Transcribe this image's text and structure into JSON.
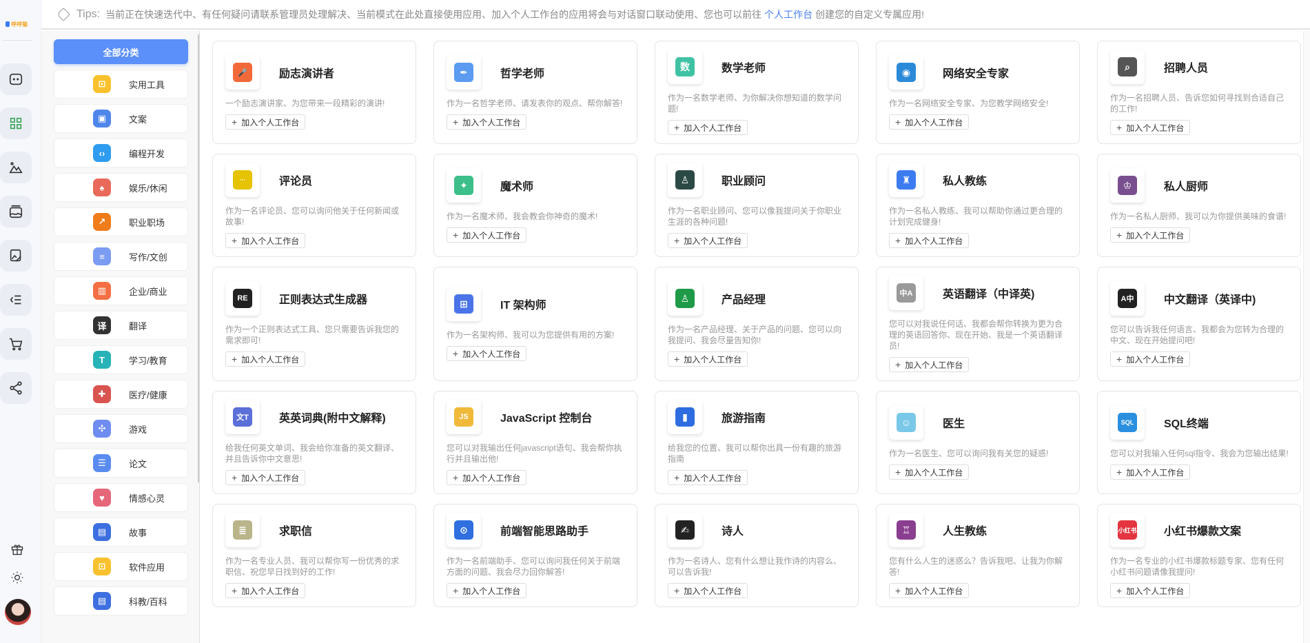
{
  "logo_text": "呼呼猫",
  "header": {
    "tips_label": "Tips:",
    "tips_before": "当前正在快速迭代中、有任何疑问请联系管理员处理解决、当前模式在此处直接使用应用、加入个人工作台的应用将会与对话窗口联动使用、您也可以前往",
    "tips_link": "个人工作台",
    "tips_after": "创建您的自定义专属应用!"
  },
  "rail": {
    "items": [
      {
        "name": "chat-icon"
      },
      {
        "name": "apps-grid-icon",
        "active": true
      },
      {
        "name": "image-mountain-icon"
      },
      {
        "name": "gallery-icon"
      },
      {
        "name": "image-edit-icon"
      },
      {
        "name": "menu-collapse-icon"
      },
      {
        "name": "cart-icon"
      },
      {
        "name": "share-icon"
      }
    ],
    "bottom": [
      {
        "name": "gift-icon"
      },
      {
        "name": "sun-icon"
      }
    ]
  },
  "categories": {
    "all_label": "全部分类",
    "items": [
      {
        "label": "实用工具",
        "icon": "toolbox-icon",
        "color": "#f8c12d",
        "glyph": "⊡"
      },
      {
        "label": "文案",
        "icon": "copywriting-icon",
        "color": "#4f86ec",
        "glyph": "▣"
      },
      {
        "label": "编程开发",
        "icon": "code-icon",
        "color": "#2f9cf0",
        "glyph": "‹›"
      },
      {
        "label": "娱乐/休闲",
        "icon": "cards-dice-icon",
        "color": "#e96a5a",
        "glyph": "♠"
      },
      {
        "label": "职业职场",
        "icon": "career-chart-icon",
        "color": "#f07c1a",
        "glyph": "↗"
      },
      {
        "label": "写作/文创",
        "icon": "writing-icon",
        "color": "#7b9cf2",
        "glyph": "≡"
      },
      {
        "label": "企业/商业",
        "icon": "building-icon",
        "color": "#f46f43",
        "glyph": "▥"
      },
      {
        "label": "翻译",
        "icon": "translate-icon",
        "color": "#333333",
        "glyph": "译"
      },
      {
        "label": "学习/教育",
        "icon": "education-icon",
        "color": "#27b3b8",
        "glyph": "T"
      },
      {
        "label": "医疗/健康",
        "icon": "medical-icon",
        "color": "#d9534f",
        "glyph": "✚"
      },
      {
        "label": "游戏",
        "icon": "gamepad-icon",
        "color": "#6f8df0",
        "glyph": "✣"
      },
      {
        "label": "论文",
        "icon": "paper-doc-icon",
        "color": "#5a8cf0",
        "glyph": "☰"
      },
      {
        "label": "情感心灵",
        "icon": "hearts-icon",
        "color": "#e6667a",
        "glyph": "♥"
      },
      {
        "label": "故事",
        "icon": "book-icon",
        "color": "#3d6fe0",
        "glyph": "▤"
      },
      {
        "label": "软件应用",
        "icon": "toolbox-icon",
        "color": "#f8c12d",
        "glyph": "⊡"
      },
      {
        "label": "科教/百科",
        "icon": "book-icon",
        "color": "#3d6fe0",
        "glyph": "▤"
      }
    ]
  },
  "card_button_label": "加入个人工作台",
  "cards": [
    {
      "title": "励志演讲者",
      "desc": "一个励志演讲家、为您带来一段精彩的演讲!",
      "icon": "microphone-icon",
      "color": "#f26a3a",
      "glyph": "🎤"
    },
    {
      "title": "哲学老师",
      "desc": "作为一名哲学老师、请发表你的观点、帮你解答!",
      "icon": "feather-pen-icon",
      "color": "#5b9bf0",
      "glyph": "✒"
    },
    {
      "title": "数学老师",
      "desc": "作为一名数学老师、为你解决你想知道的数学问题!",
      "icon": "math-book-icon",
      "color": "#3fc2a4",
      "glyph": "数"
    },
    {
      "title": "网络安全专家",
      "desc": "作为一名网络安全专家、为您教学网络安全!",
      "icon": "globe-shield-icon",
      "color": "#2b8ad8",
      "glyph": "◉"
    },
    {
      "title": "招聘人员",
      "desc": "作为一名招聘人员、告诉您如何寻找到合适自己的工作!",
      "icon": "recruiter-monitor-icon",
      "color": "#555555",
      "glyph": "⌕"
    },
    {
      "title": "评论员",
      "desc": "作为一名评论员、您可以询问他关于任何新闻或故事!",
      "icon": "comment-bubble-icon",
      "color": "#e5c300",
      "glyph": "···"
    },
    {
      "title": "魔术师",
      "desc": "作为一名魔术师、我会教会你神奇的魔术!",
      "icon": "magic-hat-icon",
      "color": "#3cbf8a",
      "glyph": "✦"
    },
    {
      "title": "职业顾问",
      "desc": "作为一名职业顾问、您可以像我提问关于你职业生涯的各种问题!",
      "icon": "career-advisor-icon",
      "color": "#2c4a45",
      "glyph": "♙"
    },
    {
      "title": "私人教练",
      "desc": "作为一名私人教练、我可以帮助你通过更合理的计划完成健身!",
      "icon": "muscle-trainer-icon",
      "color": "#3d7bf0",
      "glyph": "♜"
    },
    {
      "title": "私人厨师",
      "desc": "作为一名私人厨师、我可以为你提供美味的食谱!",
      "icon": "chef-icon",
      "color": "#7a4f8f",
      "glyph": "♔"
    },
    {
      "title": "正则表达式生成器",
      "desc": "作为一个正则表达式工具、您只需要告诉我您的需求即可!",
      "icon": "regex-icon",
      "color": "#222222",
      "glyph": "RE"
    },
    {
      "title": "IT 架构师",
      "desc": "作为一名架构师、我可以为您提供有用的方案!",
      "icon": "architecture-tree-icon",
      "color": "#4a74e8",
      "glyph": "⊞"
    },
    {
      "title": "产品经理",
      "desc": "作为一名产品经理、关于产品的问题、您可以向我提问、我会尽量告知你!",
      "icon": "product-manager-icon",
      "color": "#1f9a48",
      "glyph": "♙"
    },
    {
      "title": "英语翻译（中译英)",
      "desc": "您可以对我说任何话、我都会帮你转换为更为合理的英语回答你、现在开始、我是一个英语翻译员!",
      "icon": "zh-to-en-icon",
      "color": "#9a9a9a",
      "glyph": "中A"
    },
    {
      "title": "中文翻译（英译中)",
      "desc": "您可以告诉我任何语言、我都会为您转为合理的中文、现在开始提问吧!",
      "icon": "en-to-zh-icon",
      "color": "#222222",
      "glyph": "A中"
    },
    {
      "title": "英英词典(附中文解释)",
      "desc": "给我任何英文单词、我会给你准备的英文翻译、并且告诉你中文意思!",
      "icon": "dictionary-icon",
      "color": "#5b6fd8",
      "glyph": "文T"
    },
    {
      "title": "JavaScript 控制台",
      "desc": "您可以对我输出任何javascript语句、我会帮你执行并且输出他!",
      "icon": "js-file-icon",
      "color": "#f0b93a",
      "glyph": "JS"
    },
    {
      "title": "旅游指南",
      "desc": "给我您的位置、我可以帮你出具一份有趣的旅游指南",
      "icon": "travel-guide-icon",
      "color": "#2d6de0",
      "glyph": "▮"
    },
    {
      "title": "医生",
      "desc": "作为一名医生、您可以询问我有关您的疑惑!",
      "icon": "doctor-icon",
      "color": "#7ac8e8",
      "glyph": "☺"
    },
    {
      "title": "SQL终端",
      "desc": "您可以对我输入任何sql指令、我会为您输出结果!",
      "icon": "sql-file-icon",
      "color": "#2b8fe0",
      "glyph": "SQL"
    },
    {
      "title": "求职信",
      "desc": "作为一名专业人员、我可以帮你写一份优秀的求职信、祝您早日找到好的工作!",
      "icon": "cover-letter-icon",
      "color": "#b9b48a",
      "glyph": "≣"
    },
    {
      "title": "前端智能思路助手",
      "desc": "作为一名前端助手、您可以询问我任何关于前端方面的问题、我会尽力回你解答!",
      "icon": "robot-icon",
      "color": "#2f6fe0",
      "glyph": "⊙"
    },
    {
      "title": "诗人",
      "desc": "作为一名诗人、您有什么想让我作诗的内容么、可以告诉我!",
      "icon": "poet-icon",
      "color": "#222222",
      "glyph": "✍"
    },
    {
      "title": "人生教练",
      "desc": "您有什么人生的迷惑么？告诉我吧、让我为你解答!",
      "icon": "lighthouse-icon",
      "color": "#8a3e8f",
      "glyph": "♖"
    },
    {
      "title": "小红书爆款文案",
      "desc": "作为一名专业的小红书爆款标题专家、您有任何小红书问题请像我提问!",
      "icon": "xiaohongshu-icon",
      "color": "#e3343f",
      "glyph": "小红书"
    }
  ]
}
